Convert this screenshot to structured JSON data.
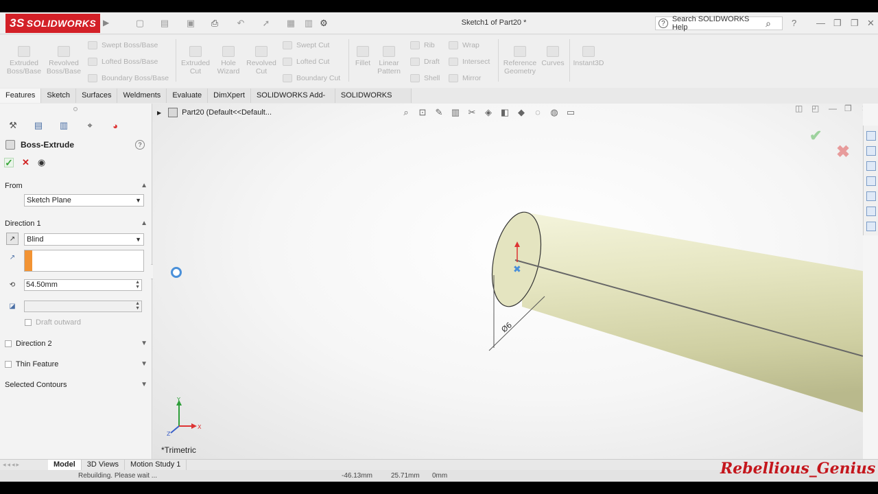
{
  "app": {
    "logo": "SOLIDWORKS",
    "logo_mark": "3S",
    "window_title": "Sketch1 of Part20 *",
    "search_placeholder": "Search SOLIDWORKS Help"
  },
  "command_manager": {
    "extruded_boss": "Extruded Boss/Base",
    "revolved_boss": "Revolved Boss/Base",
    "swept_boss": "Swept Boss/Base",
    "lofted_boss": "Lofted Boss/Base",
    "boundary_boss": "Boundary Boss/Base",
    "extruded_cut": "Extruded Cut",
    "hole_wizard": "Hole Wizard",
    "revolved_cut": "Revolved Cut",
    "swept_cut": "Swept Cut",
    "lofted_cut": "Lofted Cut",
    "boundary_cut": "Boundary Cut",
    "fillet": "Fillet",
    "linear_pattern": "Linear Pattern",
    "rib": "Rib",
    "draft": "Draft",
    "shell": "Shell",
    "wrap": "Wrap",
    "intersect": "Intersect",
    "mirror": "Mirror",
    "reference_geometry": "Reference Geometry",
    "curves": "Curves",
    "instant3d": "Instant3D"
  },
  "tabs": [
    "Features",
    "Sketch",
    "Surfaces",
    "Weldments",
    "Evaluate",
    "DimXpert",
    "SOLIDWORKS Add-Ins",
    "SOLIDWORKS MBD"
  ],
  "property_manager": {
    "title": "Boss-Extrude",
    "from_label": "From",
    "from_value": "Sketch Plane",
    "direction1_label": "Direction 1",
    "end_condition": "Blind",
    "depth": "54.50mm",
    "draft_outward": "Draft outward",
    "direction2": "Direction 2",
    "thin_feature": "Thin Feature",
    "selected_contours": "Selected Contours"
  },
  "viewport": {
    "tree_label": "Part20  (Default<<Default...",
    "orientation": "*Trimetric",
    "dimension_label": "Ø6"
  },
  "bottom_tabs": [
    "Model",
    "3D Views",
    "Motion Study 1"
  ],
  "status": {
    "message": "Rebuilding. Please wait ...",
    "x": "-46.13mm",
    "y": "25.71mm",
    "z": "0mm"
  },
  "watermark": "Rebellious_Genius",
  "colors": {
    "brand": "#d32027",
    "cylinder": "#e4e4c0",
    "accent_orange": "#f29333"
  }
}
